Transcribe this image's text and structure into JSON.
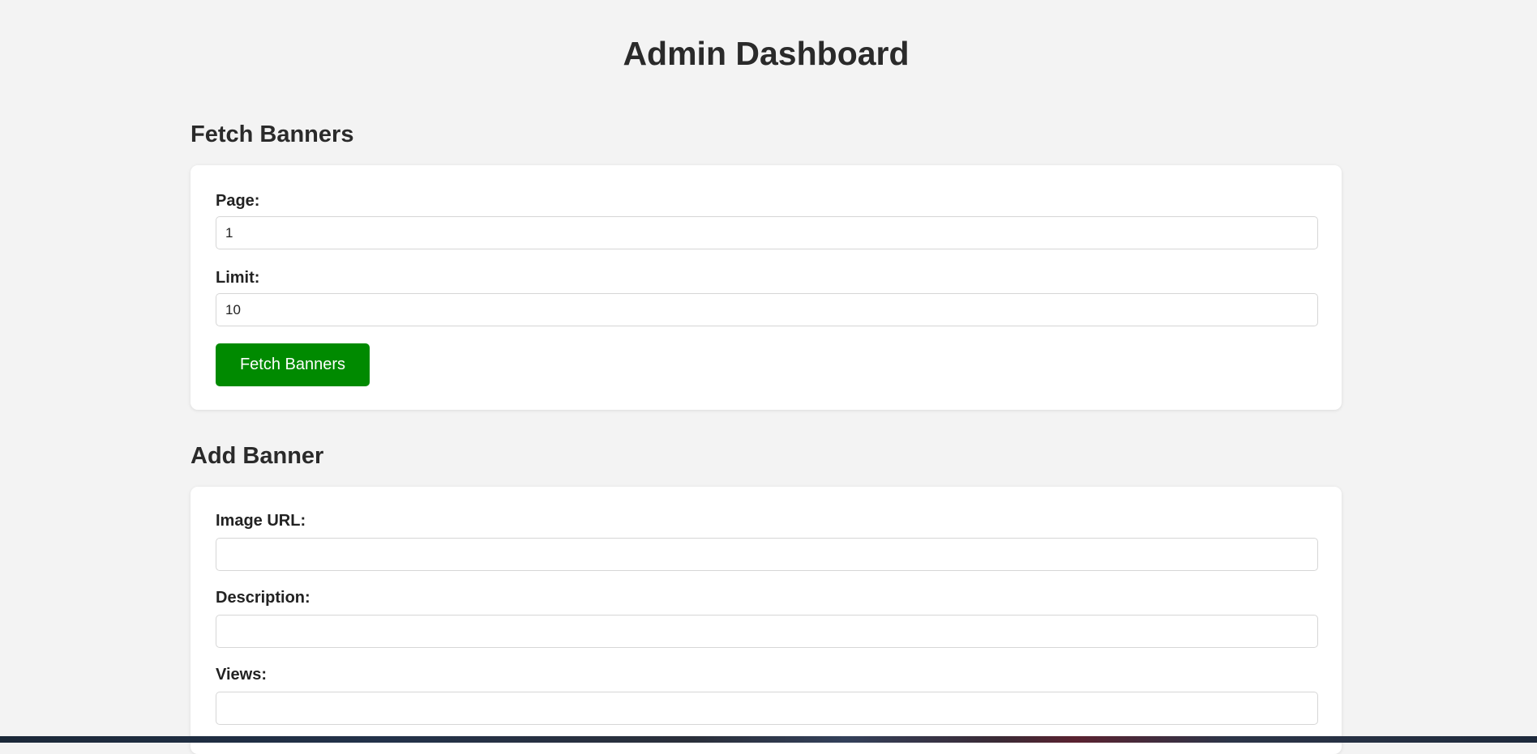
{
  "page": {
    "title": "Admin Dashboard"
  },
  "fetch_section": {
    "title": "Fetch Banners",
    "page_label": "Page:",
    "page_value": "1",
    "limit_label": "Limit:",
    "limit_value": "10",
    "button_label": "Fetch Banners"
  },
  "add_section": {
    "title": "Add Banner",
    "image_url_label": "Image URL:",
    "image_url_value": "",
    "description_label": "Description:",
    "description_value": "",
    "views_label": "Views:",
    "views_value": ""
  },
  "colors": {
    "background": "#f3f3f3",
    "card": "#ffffff",
    "primary_button": "#008a00",
    "text": "#222222"
  }
}
